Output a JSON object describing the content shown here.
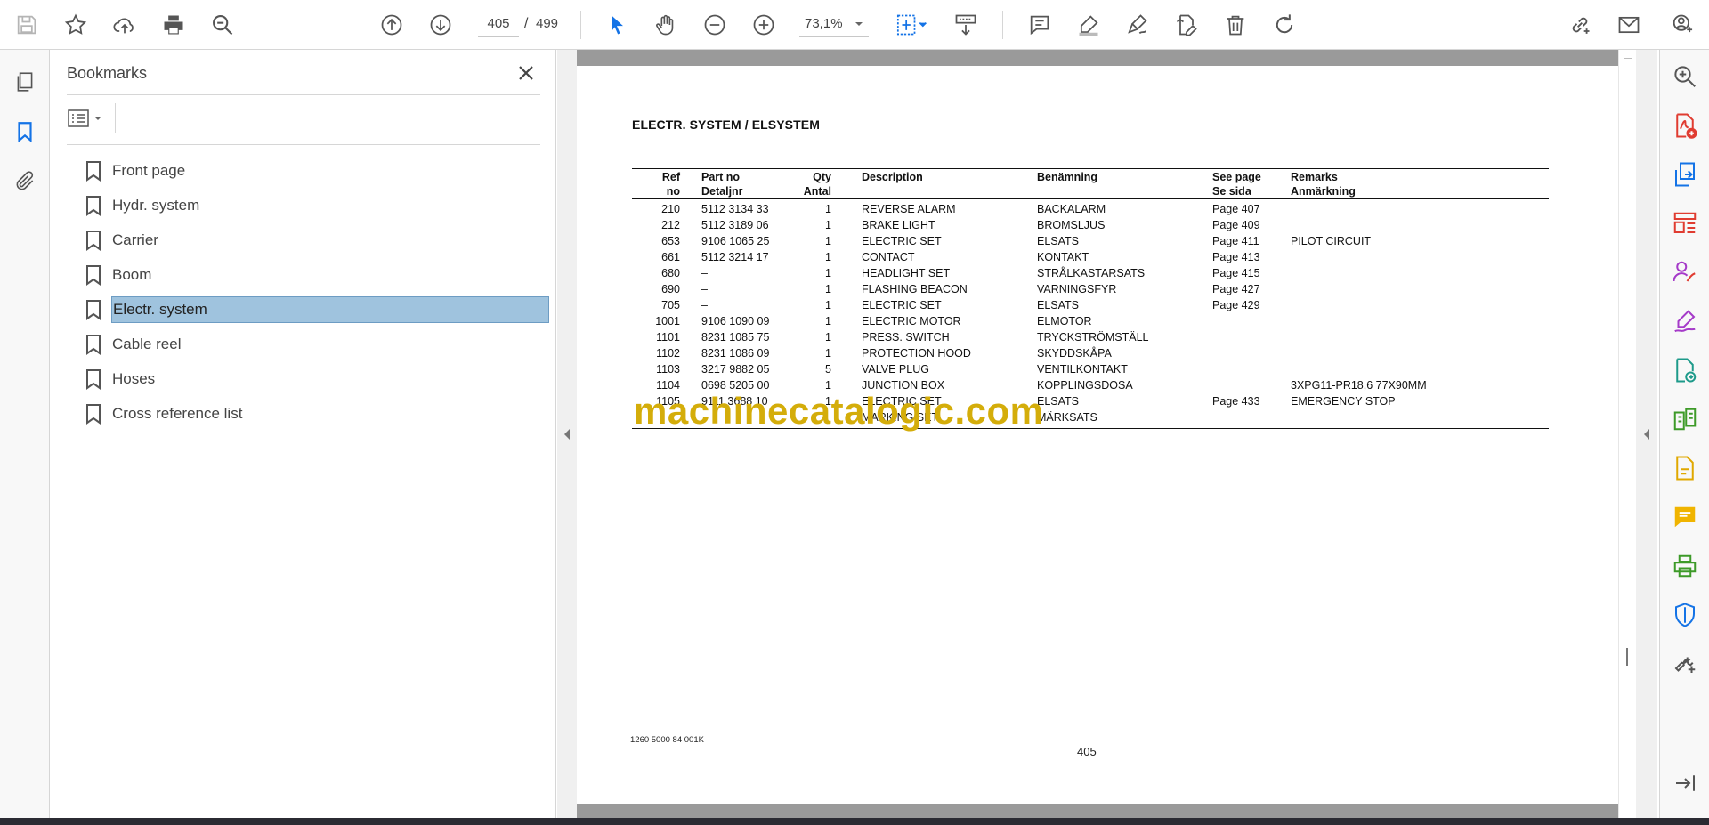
{
  "toolbar": {
    "page_current": "405",
    "page_separator": "/",
    "page_total": "499",
    "zoom_level": "73,1%",
    "icons": [
      "save-icon",
      "star-icon",
      "cloud-upload-icon",
      "print-icon",
      "search-zoom-icon",
      "page-up-icon",
      "page-down-icon",
      "select-cursor-icon",
      "hand-icon",
      "zoom-out-icon",
      "zoom-in-icon",
      "fit-page-icon",
      "scroll-mode-icon",
      "comment-icon",
      "highlight-icon",
      "sign-icon",
      "edit-pdf-icon",
      "delete-icon",
      "rotate-icon",
      "share-link-icon",
      "email-icon",
      "account-icon"
    ]
  },
  "left_rail": {
    "icons": [
      "pages-icon",
      "bookmark-icon",
      "attachment-icon"
    ],
    "accent": "#1473e6"
  },
  "bookmarks": {
    "title": "Bookmarks",
    "items": [
      {
        "label": "Front page",
        "selected": false
      },
      {
        "label": "Hydr. system",
        "selected": false
      },
      {
        "label": "Carrier",
        "selected": false
      },
      {
        "label": "Boom",
        "selected": false
      },
      {
        "label": "Electr. system",
        "selected": true
      },
      {
        "label": "Cable reel",
        "selected": false
      },
      {
        "label": "Hoses",
        "selected": false
      },
      {
        "label": "Cross reference list",
        "selected": false
      }
    ],
    "selected_color": "#9fc3de"
  },
  "document": {
    "heading": "ELECTR. SYSTEM / ELSYSTEM",
    "columns": [
      {
        "line1": "Ref",
        "line2": "no"
      },
      {
        "line1": "Part no",
        "line2": "Detaljnr"
      },
      {
        "line1": "Qty",
        "line2": "Antal"
      },
      {
        "line1": "Description",
        "line2": ""
      },
      {
        "line1": "Benämning",
        "line2": ""
      },
      {
        "line1": "See page",
        "line2": "Se sida"
      },
      {
        "line1": "Remarks",
        "line2": "Anmärkning"
      }
    ],
    "rows": [
      {
        "ref": "210",
        "part": "5112 3134 33",
        "qty": "1",
        "desc": "REVERSE ALARM",
        "ben": "BACKALARM",
        "see": "Page 407",
        "rem": ""
      },
      {
        "ref": "212",
        "part": "5112 3189 06",
        "qty": "1",
        "desc": "BRAKE LIGHT",
        "ben": "BROMSLJUS",
        "see": "Page 409",
        "rem": ""
      },
      {
        "ref": "653",
        "part": "9106 1065 25",
        "qty": "1",
        "desc": "ELECTRIC SET",
        "ben": "ELSATS",
        "see": "Page 411",
        "rem": "PILOT CIRCUIT"
      },
      {
        "ref": "661",
        "part": "5112 3214 17",
        "qty": "1",
        "desc": "CONTACT",
        "ben": "KONTAKT",
        "see": "Page 413",
        "rem": ""
      },
      {
        "ref": "680",
        "part": "–",
        "qty": "1",
        "desc": "HEADLIGHT SET",
        "ben": "STRÅLKASTARSATS",
        "see": "Page 415",
        "rem": ""
      },
      {
        "ref": "690",
        "part": "–",
        "qty": "1",
        "desc": "FLASHING BEACON",
        "ben": "VARNINGSFYR",
        "see": "Page 427",
        "rem": ""
      },
      {
        "ref": "705",
        "part": "–",
        "qty": "1",
        "desc": "ELECTRIC SET",
        "ben": "ELSATS",
        "see": "Page 429",
        "rem": ""
      },
      {
        "ref": "1001",
        "part": "9106 1090 09",
        "qty": "1",
        "desc": "ELECTRIC MOTOR",
        "ben": "ELMOTOR",
        "see": "",
        "rem": ""
      },
      {
        "ref": "1101",
        "part": "8231 1085 75",
        "qty": "1",
        "desc": "PRESS. SWITCH",
        "ben": "TRYCKSTRÖMSTÄLL",
        "see": "",
        "rem": ""
      },
      {
        "ref": "1102",
        "part": "8231 1086 09",
        "qty": "1",
        "desc": "PROTECTION HOOD",
        "ben": "SKYDDSKÅPA",
        "see": "",
        "rem": ""
      },
      {
        "ref": "1103",
        "part": "3217 9882 05",
        "qty": "5",
        "desc": "VALVE PLUG",
        "ben": "VENTILKONTAKT",
        "see": "",
        "rem": ""
      },
      {
        "ref": "1104",
        "part": "0698 5205 00",
        "qty": "1",
        "desc": "JUNCTION BOX",
        "ben": "KOPPLINGSDOSA",
        "see": "",
        "rem": "3XPG11-PR18,6 77X90MM"
      },
      {
        "ref": "1105",
        "part": "9111 3688 10",
        "qty": "1",
        "desc": "ELECTRIC SET",
        "ben": "ELSATS",
        "see": "Page 433",
        "rem": "EMERGENCY STOP"
      },
      {
        "ref": "",
        "part": "",
        "qty": "",
        "desc": "MARKING SET",
        "ben": "MÄRKSATS",
        "see": "",
        "rem": ""
      }
    ],
    "watermark": "machinecatalogic.com",
    "footer_code": "1260 5000 84  001K",
    "page_number": "405",
    "watermark_color": "#d4ad0a"
  },
  "right_rail": {
    "icons": [
      "search-tool-icon",
      "create-pdf-icon",
      "export-pdf-icon",
      "organize-pages-icon",
      "request-signature-icon",
      "fill-sign-icon",
      "send-track-icon",
      "compare-icon",
      "scan-icon",
      "comment-tool-icon",
      "print-production-icon",
      "protect-icon",
      "more-tools-icon",
      "collapse-panel-icon"
    ]
  }
}
